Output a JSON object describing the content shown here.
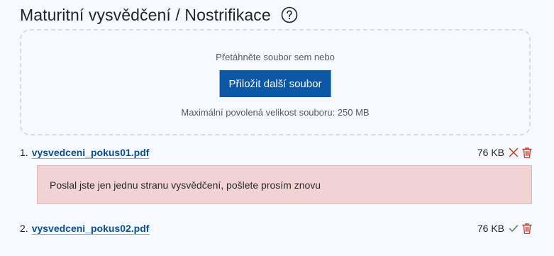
{
  "section": {
    "title": "Maturitní vysvědčení / Nostrifikace",
    "help_icon": "question-circle-icon"
  },
  "dropzone": {
    "hint": "Přetáhněte soubor sem nebo",
    "button_label": "Přiložit další soubor",
    "max_size_text": "Maximální povolená velikost souboru: 250 MB"
  },
  "files": [
    {
      "index": "1.",
      "name": "vysvedceni_pokus01.pdf",
      "size": "76 KB",
      "status": "rejected",
      "status_icon": "x-icon",
      "error_message": "Poslal jste jen jednu stranu vysvědčení, pošlete prosím znovu"
    },
    {
      "index": "2.",
      "name": "vysvedceni_pokus02.pdf",
      "size": "76 KB",
      "status": "accepted",
      "status_icon": "check-icon"
    }
  ],
  "colors": {
    "primary": "#0a58a6",
    "link": "#0a4f94",
    "danger": "#c0392b",
    "success": "#3c8f4a",
    "error_bg": "#f1d3d3"
  }
}
